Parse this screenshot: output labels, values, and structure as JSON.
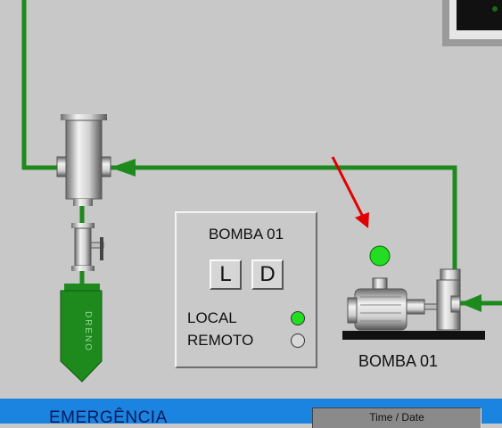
{
  "panel": {
    "title": "BOMBA 01",
    "buttons": {
      "local_btn": "L",
      "remote_btn": "D"
    },
    "local_label": "LOCAL",
    "remote_label": "REMOTO",
    "local_lamp_color": "#22dd22",
    "remote_lamp_color": "#d8d8d8"
  },
  "pump": {
    "label": "BOMBA 01",
    "status_lamp_color": "#22dd22"
  },
  "drain": {
    "label": "DRENO"
  },
  "footer": {
    "emergency_label": "EMERGÊNCIA",
    "time_date_label": "Time / Date"
  },
  "colors": {
    "pipe": "#1e8a1e",
    "background": "#c8c8c8",
    "footer_bar": "#1a84e0",
    "indicator_arrow": "#e00000"
  }
}
